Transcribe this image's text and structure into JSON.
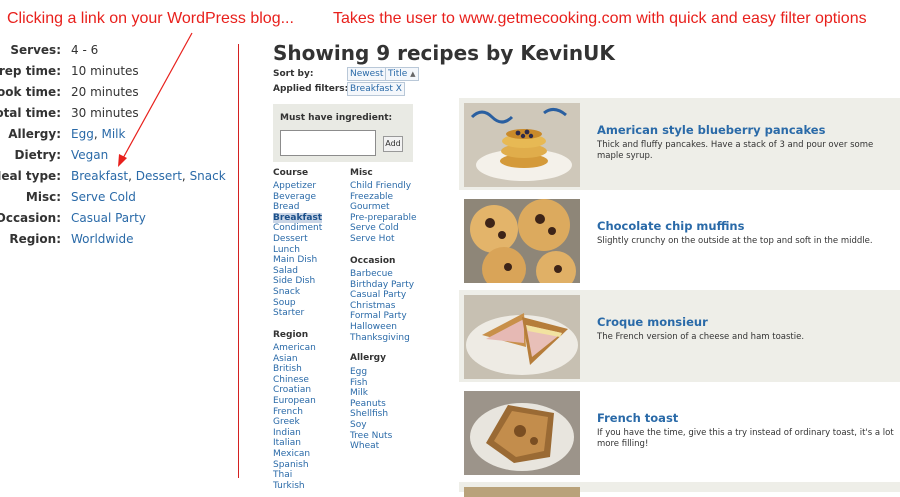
{
  "annotations": {
    "left": "Clicking a link on your WordPress blog...",
    "right": "Takes the user to www.getmecooking.com with quick and easy filter options",
    "color": "#e8201c"
  },
  "wordpress_meta": [
    {
      "label": "Serves:",
      "value": "4 - 6",
      "links": []
    },
    {
      "label": "Prep time:",
      "value": "10 minutes",
      "links": []
    },
    {
      "label": "Cook time:",
      "value": "20 minutes",
      "links": []
    },
    {
      "label": "Total time:",
      "value": "30 minutes",
      "links": []
    },
    {
      "label": "Allergy:",
      "links": [
        "Egg",
        "Milk"
      ]
    },
    {
      "label": "Dietry:",
      "links": [
        "Vegan"
      ]
    },
    {
      "label": "Meal type:",
      "links": [
        "Breakfast",
        "Dessert",
        "Snack"
      ]
    },
    {
      "label": "Misc:",
      "links": [
        "Serve Cold"
      ]
    },
    {
      "label": "Occasion:",
      "links": [
        "Casual Party"
      ]
    },
    {
      "label": "Region:",
      "links": [
        "Worldwide"
      ]
    }
  ],
  "site": {
    "title": "Showing 9 recipes by KevinUK",
    "sort_label": "Sort by:",
    "sort_options": [
      "Newest",
      "Title"
    ],
    "filters_label": "Applied filters:",
    "applied_filters": [
      "Breakfast X"
    ],
    "ingredient": {
      "label": "Must have ingredient:",
      "placeholder": "",
      "value": "",
      "add_label": "Add"
    },
    "categories": {
      "course": {
        "title": "Course",
        "items": [
          "Appetizer",
          "Beverage",
          "Bread",
          "Breakfast",
          "Condiment",
          "Dessert",
          "Lunch",
          "Main Dish",
          "Salad",
          "Side Dish",
          "Snack",
          "Soup",
          "Starter"
        ],
        "active": "Breakfast"
      },
      "region": {
        "title": "Region",
        "items": [
          "American",
          "Asian",
          "British",
          "Chinese",
          "Croatian",
          "European",
          "French",
          "Greek",
          "Indian",
          "Italian",
          "Mexican",
          "Spanish",
          "Thai",
          "Turkish"
        ]
      },
      "misc": {
        "title": "Misc",
        "items": [
          "Child Friendly",
          "Freezable",
          "Gourmet",
          "Pre-preparable",
          "Serve Cold",
          "Serve Hot"
        ]
      },
      "occasion": {
        "title": "Occasion",
        "items": [
          "Barbecue",
          "Birthday Party",
          "Casual Party",
          "Christmas",
          "Formal Party",
          "Halloween",
          "Thanksgiving"
        ]
      },
      "allergy": {
        "title": "Allergy",
        "items": [
          "Egg",
          "Fish",
          "Milk",
          "Peanuts",
          "Shellfish",
          "Soy",
          "Tree Nuts",
          "Wheat"
        ]
      }
    },
    "recipes": [
      {
        "title": "American style blueberry pancakes",
        "description": "Thick and fluffy pancakes. Have a stack of 3 and pour over some maple syrup."
      },
      {
        "title": "Chocolate chip muffins",
        "description": "Slightly crunchy on the outside at the top and soft in the middle."
      },
      {
        "title": "Croque monsieur",
        "description": "The French version of a cheese and ham toastie."
      },
      {
        "title": "French toast",
        "description": "If you have the time, give this a try instead of ordinary toast, it's a lot more filling!"
      }
    ]
  },
  "colors": {
    "link": "#2a6aa8",
    "alt_row": "#eeeee8",
    "divider": "#d42020"
  }
}
